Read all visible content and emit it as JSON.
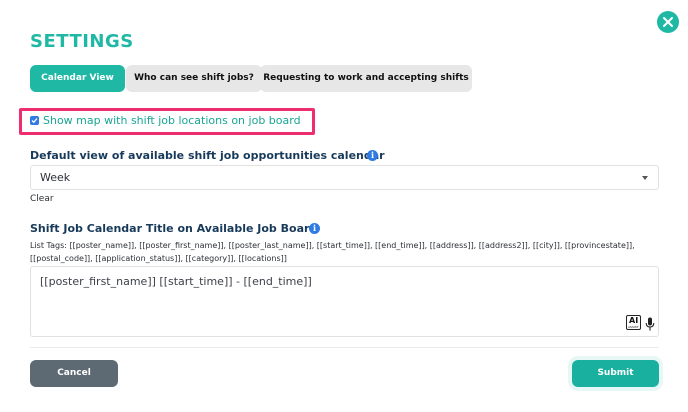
{
  "dialog": {
    "title": "SETTINGS",
    "close_icon": "close-icon"
  },
  "tabs": [
    {
      "label": "Calendar View",
      "active": true
    },
    {
      "label": "Who can see shift jobs?",
      "active": false
    },
    {
      "label": "Requesting to work and accepting shifts",
      "active": false
    }
  ],
  "map_option": {
    "label": "Show map with shift job locations on job board",
    "checked": true,
    "highlight_color": "#ef2e70"
  },
  "default_view": {
    "label": "Default view of available shift job opportunities calendar",
    "value": "Week",
    "clear_label": "Clear"
  },
  "calendar_title": {
    "label": "Shift Job Calendar Title on Available Job Board",
    "list_tags": "List Tags: [[poster_name]], [[poster_first_name]], [[poster_last_name]], [[start_time]], [[end_time]], [[address]], [[address2]], [[city]], [[provincestate]], [[postal_code]], [[application_status]], [[category]], [[locations]]",
    "value": "[[poster_first_name]] [[start_time]] - [[end_time]]",
    "ai_label": "AI",
    "ai_sublabel": "ASSIST"
  },
  "actions": {
    "cancel_label": "Cancel",
    "submit_label": "Submit"
  },
  "colors": {
    "accent": "#1fb8a5",
    "info": "#2f7be3",
    "cancel": "#5e6a73"
  }
}
